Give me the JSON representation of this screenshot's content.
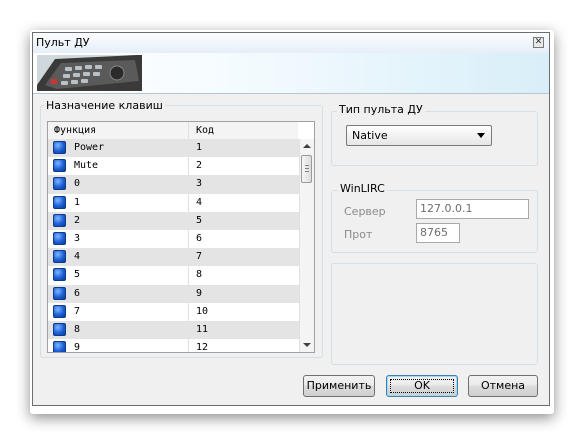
{
  "window": {
    "title": "Пульт ДУ",
    "close_glyph": "✕"
  },
  "keys": {
    "group_title": "Назначение клавиш",
    "columns": [
      "Функция",
      "Код"
    ],
    "rows": [
      {
        "fn": "Power",
        "code": "1"
      },
      {
        "fn": "Mute",
        "code": "2"
      },
      {
        "fn": "0",
        "code": "3"
      },
      {
        "fn": "1",
        "code": "4"
      },
      {
        "fn": "2",
        "code": "5"
      },
      {
        "fn": "3",
        "code": "6"
      },
      {
        "fn": "4",
        "code": "7"
      },
      {
        "fn": "5",
        "code": "8"
      },
      {
        "fn": "6",
        "code": "9"
      },
      {
        "fn": "7",
        "code": "10"
      },
      {
        "fn": "8",
        "code": "11"
      },
      {
        "fn": "9",
        "code": "12"
      }
    ]
  },
  "remote_type": {
    "group_title": "Тип пульта ДУ",
    "selected": "Native"
  },
  "winlirc": {
    "group_title": "WinLIRC",
    "server_label": "Сервер",
    "server_value": "127.0.0.1",
    "port_label": "Прот",
    "port_value": "8765"
  },
  "buttons": {
    "apply": "Применить",
    "ok": "OK",
    "cancel": "Отмена"
  },
  "colors": {
    "row_icon": "#1d5fd6",
    "alt_row": "#e4e4e4",
    "banner_accent": "#d8eef8"
  }
}
